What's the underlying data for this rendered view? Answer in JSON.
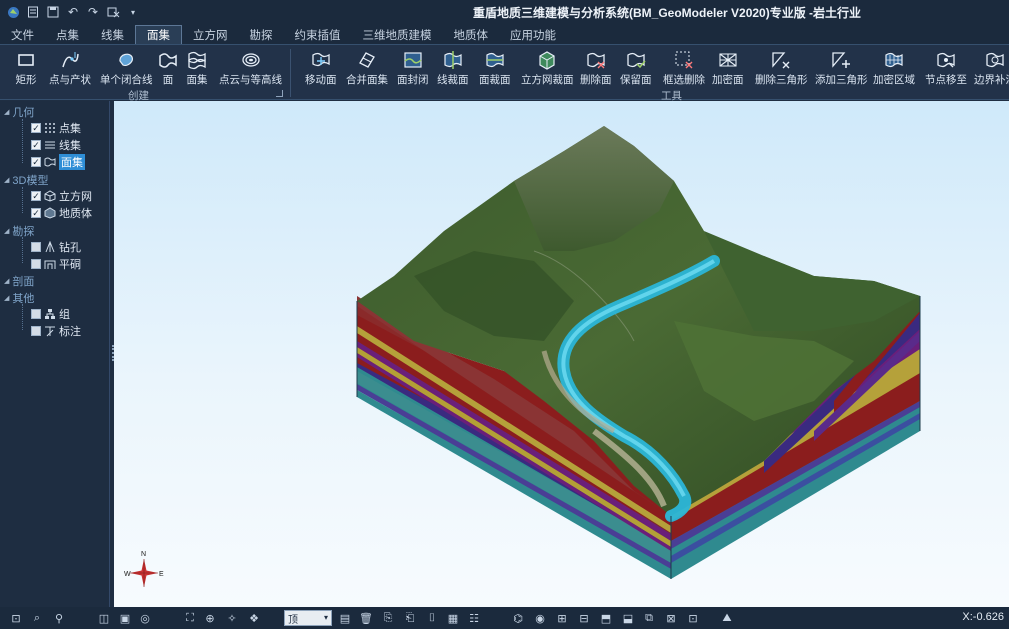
{
  "window": {
    "title": "重盾地质三维建模与分析系统(BM_GeoModeler V2020)专业版 -岩土行业"
  },
  "menu": {
    "tabs": [
      {
        "label": "文件"
      },
      {
        "label": "点集"
      },
      {
        "label": "线集"
      },
      {
        "label": "面集"
      },
      {
        "label": "立方网"
      },
      {
        "label": "勘探"
      },
      {
        "label": "约束插值"
      },
      {
        "label": "三维地质建模"
      },
      {
        "label": "地质体"
      },
      {
        "label": "应用功能"
      }
    ],
    "active": "面集"
  },
  "ribbon": {
    "create": {
      "label": "创建",
      "buttons": [
        {
          "label": "矩形"
        },
        {
          "label": "点与产状"
        },
        {
          "label": "单个闭合线"
        },
        {
          "label": "面"
        },
        {
          "label": "面集"
        },
        {
          "label": "点云与等高线"
        }
      ]
    },
    "tools": {
      "label": "工具",
      "buttons": [
        {
          "label": "移动面"
        },
        {
          "label": "合并面集"
        },
        {
          "label": "面封闭"
        },
        {
          "label": "线裁面"
        },
        {
          "label": "面裁面"
        },
        {
          "label": "立方网裁面"
        },
        {
          "label": "删除面"
        },
        {
          "label": "保留面"
        },
        {
          "label": "框选删除"
        },
        {
          "label": "加密面"
        },
        {
          "label": "删除三角形"
        },
        {
          "label": "添加三角形"
        },
        {
          "label": "加密区域"
        },
        {
          "label": "节点移至"
        },
        {
          "label": "边界补洞"
        }
      ]
    }
  },
  "tree": {
    "categories": [
      {
        "label": "几何"
      },
      {
        "label": "3D模型"
      },
      {
        "label": "勘探"
      },
      {
        "label": "剖面"
      },
      {
        "label": "其他"
      }
    ],
    "items": [
      {
        "label": "点集",
        "checked": true
      },
      {
        "label": "线集",
        "checked": true
      },
      {
        "label": "面集",
        "checked": true,
        "selected": true
      },
      {
        "label": "立方网",
        "checked": true
      },
      {
        "label": "地质体",
        "checked": true
      },
      {
        "label": "钻孔",
        "checked": false
      },
      {
        "label": "平硐",
        "checked": false
      },
      {
        "label": "组",
        "checked": false
      },
      {
        "label": "标注",
        "checked": false
      }
    ]
  },
  "compass": {
    "n": "N",
    "w": "W",
    "e": "E"
  },
  "status": {
    "view_option": "顶",
    "coordinate": "X:-0.626"
  }
}
